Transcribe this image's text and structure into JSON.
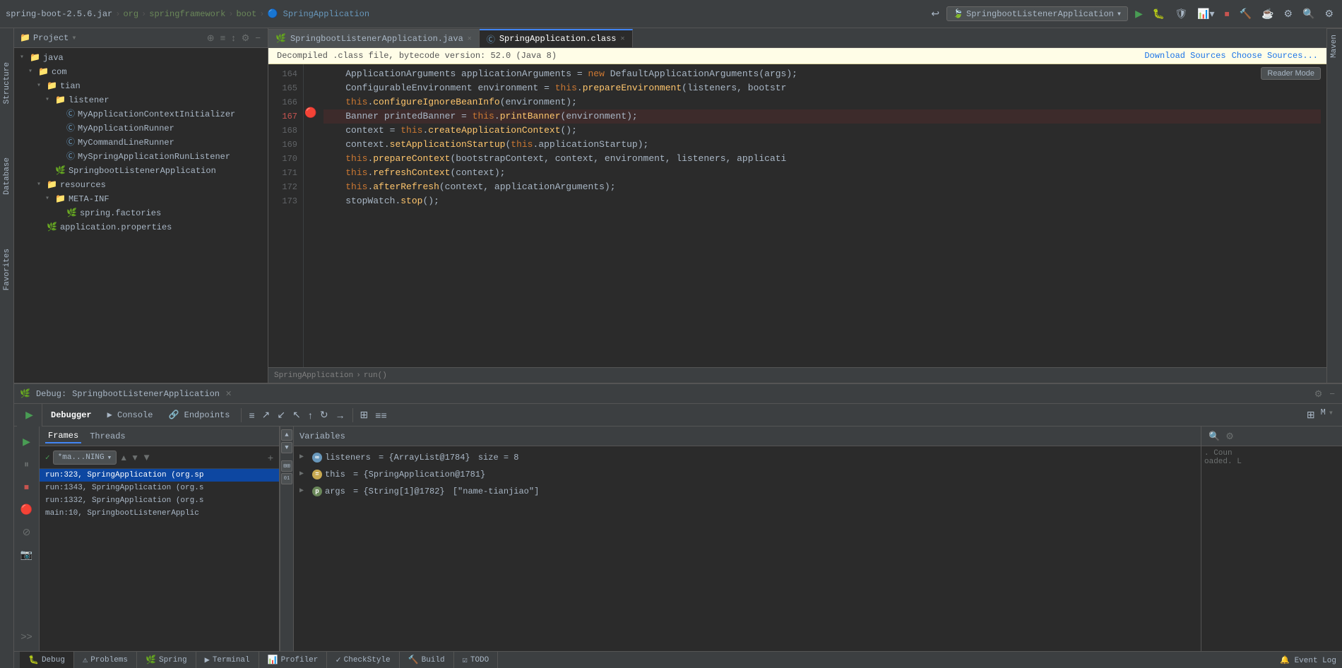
{
  "topbar": {
    "breadcrumbs": [
      "spring-boot-2.5.6.jar",
      "org",
      "springframework",
      "boot",
      "SpringApplication"
    ],
    "run_config": "SpringbootListenerApplication",
    "chevron": "▾"
  },
  "project_panel": {
    "title": "Project",
    "items": [
      {
        "indent": 0,
        "type": "folder",
        "name": "java",
        "expanded": true
      },
      {
        "indent": 1,
        "type": "folder",
        "name": "com",
        "expanded": true
      },
      {
        "indent": 2,
        "type": "folder",
        "name": "tian",
        "expanded": true
      },
      {
        "indent": 3,
        "type": "folder",
        "name": "listener",
        "expanded": true
      },
      {
        "indent": 4,
        "type": "class",
        "name": "MyApplicationContextInitializer"
      },
      {
        "indent": 4,
        "type": "class",
        "name": "MyApplicationRunner"
      },
      {
        "indent": 4,
        "type": "class",
        "name": "MyCommandLineRunner"
      },
      {
        "indent": 4,
        "type": "class",
        "name": "MySpringApplicationRunListener"
      },
      {
        "indent": 3,
        "type": "class-spring",
        "name": "SpringbootListenerApplication"
      },
      {
        "indent": 2,
        "type": "folder",
        "name": "resources",
        "expanded": true
      },
      {
        "indent": 3,
        "type": "folder",
        "name": "META-INF",
        "expanded": true
      },
      {
        "indent": 4,
        "type": "spring-file",
        "name": "spring.factories"
      },
      {
        "indent": 2,
        "type": "properties",
        "name": "application.properties"
      }
    ]
  },
  "editor": {
    "tabs": [
      {
        "name": "SpringbootListenerApplication.java",
        "active": false,
        "icon": "spring"
      },
      {
        "name": "SpringApplication.class",
        "active": true,
        "icon": "class"
      }
    ],
    "notice": "Decompiled .class file, bytecode version: 52.0 (Java 8)",
    "download_sources": "Download Sources",
    "choose_sources": "Choose Sources...",
    "reader_mode": "Reader Mode",
    "lines": [
      {
        "num": 164,
        "code": "    ApplicationArguments applicationArguments = new DefaultApplicationArguments(args);",
        "highlight": false,
        "breakpoint": false
      },
      {
        "num": 165,
        "code": "    ConfigurableEnvironment environment = this.prepareEnvironment(listeners, bootstr",
        "highlight": false,
        "breakpoint": false
      },
      {
        "num": 166,
        "code": "    this.configureIgnoreBeanInfo(environment);",
        "highlight": false,
        "breakpoint": false
      },
      {
        "num": 167,
        "code": "    Banner printedBanner = this.printBanner(environment);",
        "highlight": true,
        "breakpoint": true
      },
      {
        "num": 168,
        "code": "    context = this.createApplicationContext();",
        "highlight": false,
        "breakpoint": false
      },
      {
        "num": 169,
        "code": "    context.setApplicationStartup(this.applicationStartup);",
        "highlight": false,
        "breakpoint": false
      },
      {
        "num": 170,
        "code": "    this.prepareContext(bootstrapContext, context, environment, listeners, applicati",
        "highlight": false,
        "breakpoint": false
      },
      {
        "num": 171,
        "code": "    this.refreshContext(context);",
        "highlight": false,
        "breakpoint": false
      },
      {
        "num": 172,
        "code": "    this.afterRefresh(context, applicationArguments);",
        "highlight": false,
        "breakpoint": false
      },
      {
        "num": 173,
        "code": "    stopWatch.stop();",
        "highlight": false,
        "breakpoint": false
      }
    ],
    "breadcrumb": "SpringApplication  ›  run()"
  },
  "debug_panel": {
    "title": "Debug:",
    "app_name": "SpringbootListenerApplication",
    "tabs": [
      "Debugger",
      "Console",
      "Endpoints"
    ],
    "toolbar_buttons": [
      "≡",
      "↑",
      "↓",
      "↓",
      "↑",
      "↺",
      "↣",
      "⊞",
      "≡≡"
    ],
    "frames_tab": "Frames",
    "threads_tab": "Threads",
    "variables_label": "Variables",
    "thread_name": "*ma...NING",
    "frames": [
      {
        "name": "run:323, SpringApplication (org.sp",
        "selected": true
      },
      {
        "name": "run:1343, SpringApplication (org.s"
      },
      {
        "name": "run:1332, SpringApplication (org.s"
      },
      {
        "name": "main:10, SpringbootListenerApplic"
      }
    ],
    "variables": [
      {
        "icon": "∞",
        "icon_type": "infinity",
        "name": "listeners",
        "value": "= {ArrayList@1784}",
        "extra": "size = 8"
      },
      {
        "icon": "=",
        "icon_type": "equals",
        "name": "this",
        "value": "= {SpringApplication@1781}"
      },
      {
        "icon": "p",
        "icon_type": "param",
        "name": "args",
        "value": "= {String[1]@1782}",
        "extra": "['name-tianjiao']"
      }
    ]
  },
  "status_bar": {
    "tabs": [
      "Debug",
      "Problems",
      "Spring",
      "Terminal",
      "Profiler",
      "CheckStyle",
      "Build",
      "TODO"
    ],
    "icons": [
      "🐛",
      "⚠",
      "🍃",
      "▶",
      "📊",
      "✓",
      "🔨",
      "☑"
    ],
    "event_log": "Event Log"
  },
  "right_panels": [
    "Maven"
  ],
  "side_panels_left": [
    "Structure",
    "Database",
    "Favorites"
  ]
}
